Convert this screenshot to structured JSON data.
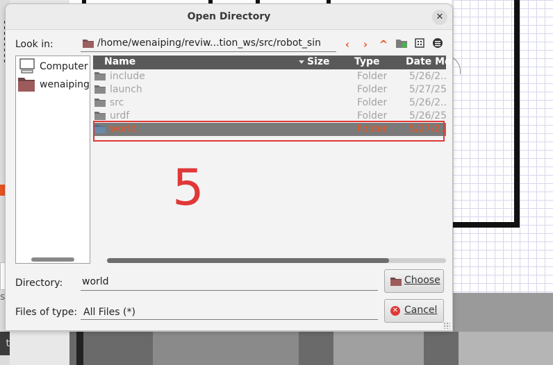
{
  "dialog": {
    "title": "Open Directory",
    "close_glyph": "✕"
  },
  "look_in": {
    "label": "Look in:",
    "path": "/home/wenaiping/reviw...tion_ws/src/robot_sin",
    "toolbar": [
      {
        "name": "back-icon",
        "glyph": "‹"
      },
      {
        "name": "forward-icon",
        "glyph": "›"
      },
      {
        "name": "parent-directory-icon",
        "glyph": "^"
      },
      {
        "name": "new-folder-icon",
        "glyph": ""
      },
      {
        "name": "list-view-icon",
        "glyph": ""
      },
      {
        "name": "detail-view-icon",
        "glyph": ""
      }
    ]
  },
  "places": [
    {
      "label": "Computer",
      "icon": "computer-icon"
    },
    {
      "label": "wenaiping",
      "icon": "home-folder-icon"
    }
  ],
  "file_list": {
    "columns": [
      "Name",
      "Size",
      "Type",
      "Date Mo"
    ],
    "rows": [
      {
        "name": "include",
        "size": "",
        "type": "Folder",
        "date": "5/26/2..."
      },
      {
        "name": "launch",
        "size": "",
        "type": "Folder",
        "date": "5/27/25"
      },
      {
        "name": "src",
        "size": "",
        "type": "Folder",
        "date": "5/26/2..."
      },
      {
        "name": "urdf",
        "size": "",
        "type": "Folder",
        "date": "5/26/25"
      },
      {
        "name": "world",
        "size": "",
        "type": "Folder",
        "date": "5/27/2..."
      }
    ],
    "selected_index": 4
  },
  "annotation": {
    "number": "5",
    "color": "#e03838"
  },
  "directory": {
    "label": "Directory:",
    "value": "world"
  },
  "files_of_type": {
    "label": "Files of type:",
    "value": "All Files (*)"
  },
  "buttons": {
    "choose": "Choose",
    "cancel": "Cancel"
  },
  "background": {
    "left_fragments": [
      "s",
      "t"
    ]
  },
  "colors": {
    "accent": "#e95420",
    "header_bg": "#595959",
    "highlight_box": "#e03838"
  }
}
